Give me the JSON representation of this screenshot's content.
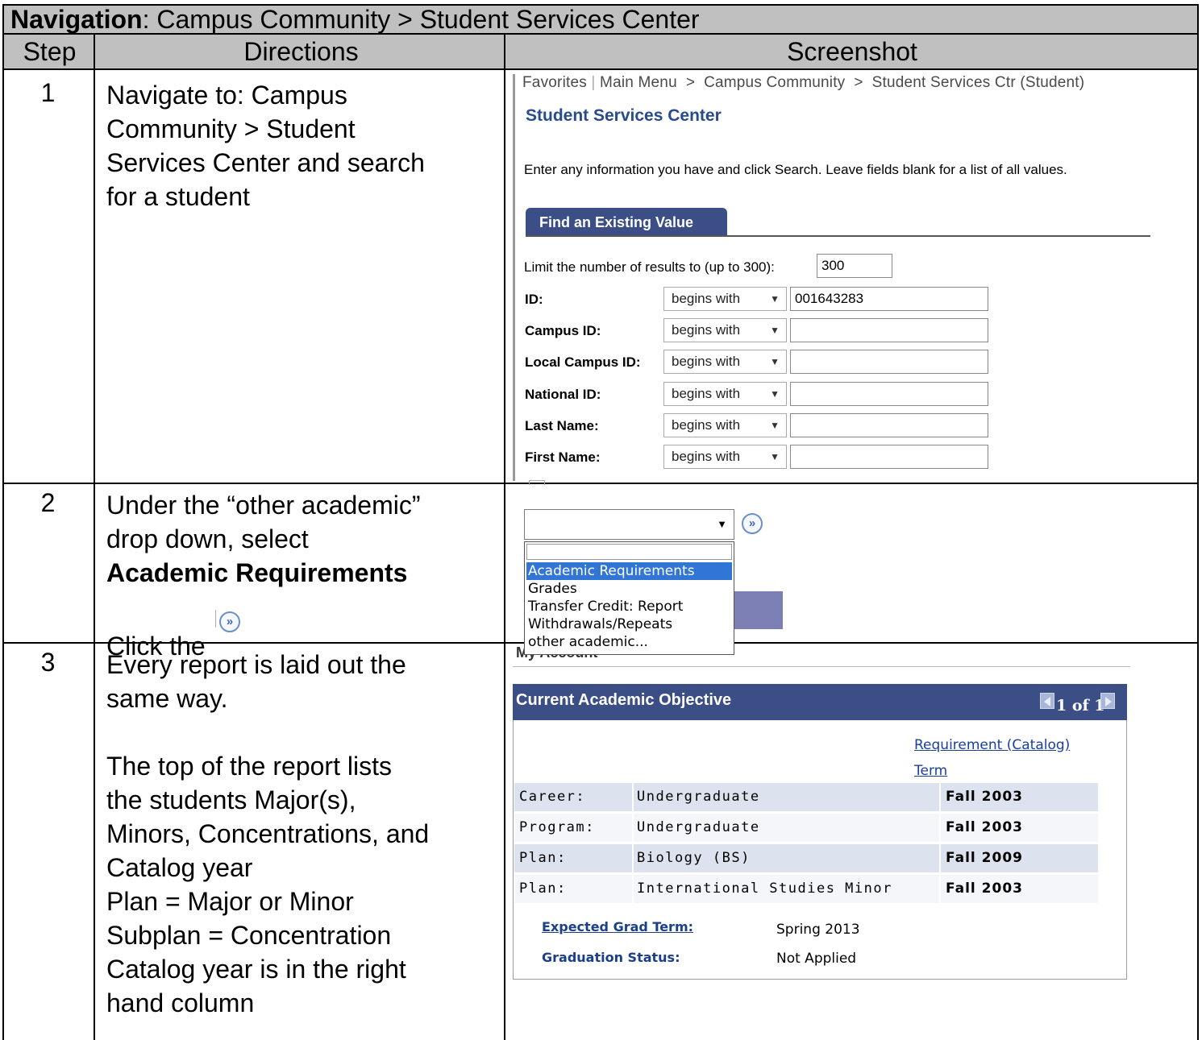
{
  "navigation": {
    "label": "Navigation",
    "path": ": Campus Community > Student Services Center"
  },
  "headers": {
    "step": "Step",
    "directions": "Directions",
    "screenshot": "Screenshot"
  },
  "rows": [
    {
      "step": "1",
      "directions": [
        "Navigate to: Campus",
        "Community > Student",
        "Services Center and search",
        "for a student"
      ]
    },
    {
      "step": "2",
      "directions": [
        "Under the “other academic”",
        "drop down, select"
      ],
      "directions_bold": "Academic Requirements",
      "click_text": "Click the"
    },
    {
      "step": "3",
      "directions": [
        "Every report is laid out the",
        "same way.",
        "",
        "The top of the report lists",
        "the students Major(s),",
        "Minors, Concentrations, and",
        "Catalog year",
        "Plan = Major or Minor",
        "Subplan = Concentration",
        "Catalog year is in the right",
        "hand column"
      ]
    }
  ],
  "search_screen": {
    "breadcrumb": {
      "favorites": "Favorites",
      "main_menu": "Main Menu",
      "sep": ">",
      "campus_community": "Campus Community",
      "current": "Student Services Ctr (Student)"
    },
    "title": "Student Services Center",
    "instructions": "Enter any information you have and click Search. Leave fields blank for a list of all values.",
    "tab": "Find an Existing Value",
    "limit_label": "Limit the number of results to (up to 300):",
    "limit_value": "300",
    "operator": "begins with",
    "fields": [
      {
        "label": "ID:",
        "value": "001643283"
      },
      {
        "label": "Campus ID:",
        "value": ""
      },
      {
        "label": "Local Campus ID:",
        "value": ""
      },
      {
        "label": "National ID:",
        "value": ""
      },
      {
        "label": "Last Name:",
        "value": ""
      },
      {
        "label": "First Name:",
        "value": ""
      }
    ]
  },
  "dropdown_screen": {
    "go_glyph": "»",
    "options": [
      "Academic Requirements",
      "Grades",
      "Transfer Credit: Report",
      "Withdrawals/Repeats",
      "other academic..."
    ],
    "selected": "Academic Requirements",
    "trailing_text": "My Account"
  },
  "objective_screen": {
    "title": "Current Academic Objective",
    "pager": "1 of 1",
    "col_requirement": "Requirement (Catalog)",
    "col_term": "Term",
    "rows": [
      {
        "label": "Career:",
        "value": "Undergraduate",
        "term": "Fall 2003"
      },
      {
        "label": "Program:",
        "value": "Undergraduate",
        "term": "Fall 2003"
      },
      {
        "label": "Plan:",
        "value": "Biology (BS)",
        "term": "Fall 2009"
      },
      {
        "label": "Plan:",
        "value": "International Studies Minor",
        "term": "Fall 2003"
      }
    ],
    "expected_grad_label": "Expected Grad Term:",
    "expected_grad_value": "Spring 2013",
    "grad_status_label": "Graduation Status:",
    "grad_status_value": "Not Applied"
  },
  "colors": {
    "header_bg": "#c0c0c0",
    "ps_blue": "#3b4f86",
    "link_blue": "#1b3fa0",
    "row_shade": "#dde3ee",
    "select_blue": "#3176d6"
  }
}
